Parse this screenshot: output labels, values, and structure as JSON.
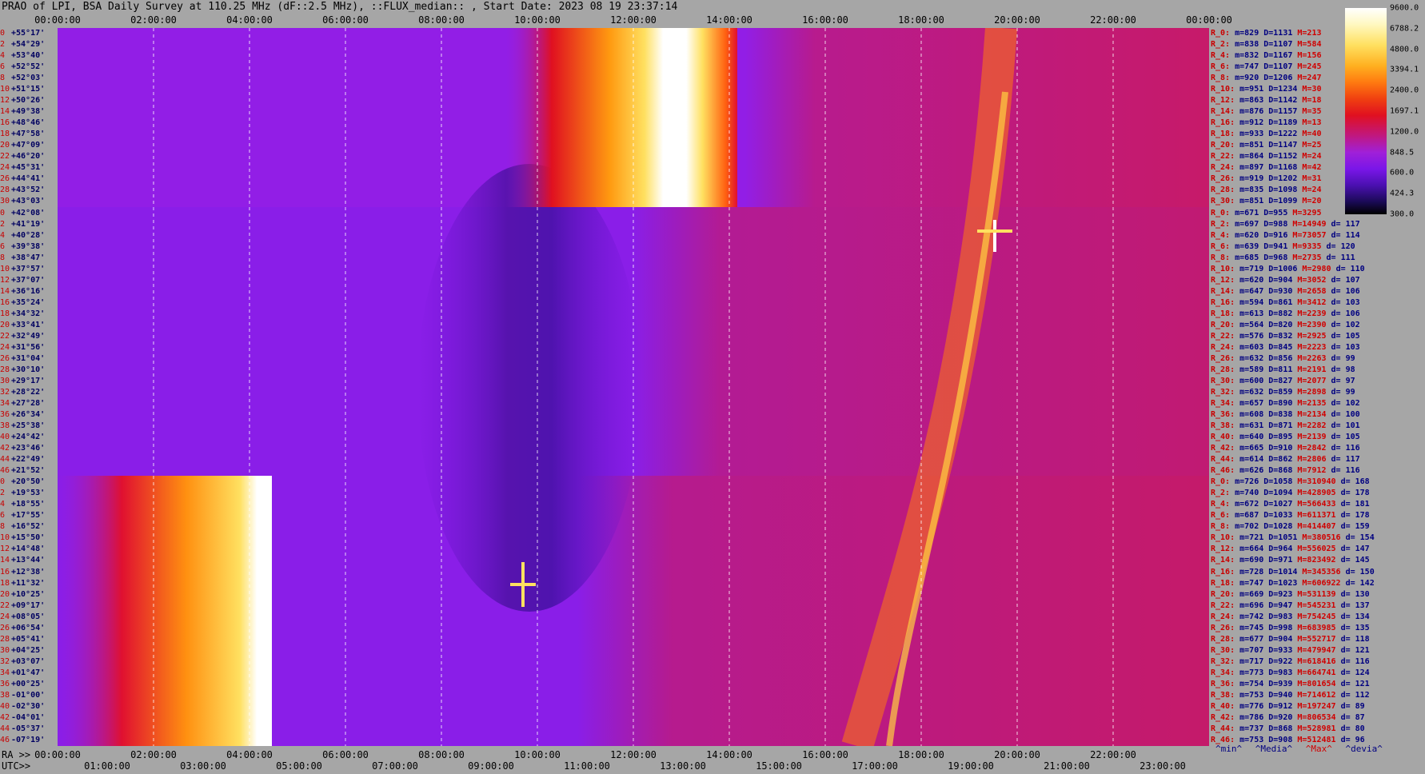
{
  "title": "PRAO of LPI, BSA Daily Survey at 110.25 MHz (dF::2.5 MHz), ::FLUX_median:: , Start Date: 2023 08 19 23:37:14",
  "top_axis": [
    "00:00:00",
    "02:00:00",
    "04:00:00",
    "06:00:00",
    "08:00:00",
    "10:00:00",
    "12:00:00",
    "14:00:00",
    "16:00:00",
    "18:00:00",
    "20:00:00",
    "22:00:00",
    "00:00:00"
  ],
  "ra_axis_label": "RA >>",
  "ra_axis": [
    "00:00:00",
    "02:00:00",
    "04:00:00",
    "06:00:00",
    "08:00:00",
    "10:00:00",
    "12:00:00",
    "14:00:00",
    "16:00:00",
    "18:00:00",
    "20:00:00",
    "22:00:00"
  ],
  "utc_axis_label": "UTC>>",
  "utc_axis": [
    "01:00:00",
    "03:00:00",
    "05:00:00",
    "07:00:00",
    "09:00:00",
    "11:00:00",
    "13:00:00",
    "15:00:00",
    "17:00:00",
    "19:00:00",
    "21:00:00",
    "23:00:00"
  ],
  "colorbar_labels": [
    "9600.0",
    "6788.2",
    "4800.0",
    "3394.1",
    "2400.0",
    "1697.1",
    "1200.0",
    "848.5",
    "600.0",
    "424.3",
    "300.0"
  ],
  "declinations": [
    "+55°17'",
    "+54°29'",
    "+53°40'",
    "+52°52'",
    "+52°03'",
    "+51°15'",
    "+50°26'",
    "+49°38'",
    "+48°46'",
    "+47°58'",
    "+47°09'",
    "+46°20'",
    "+45°31'",
    "+44°41'",
    "+43°52'",
    "+43°03'",
    "+42°08'",
    "+41°19'",
    "+40°28'",
    "+39°38'",
    "+38°47'",
    "+37°57'",
    "+37°07'",
    "+36°16'",
    "+35°24'",
    "+34°32'",
    "+33°41'",
    "+32°49'",
    "+31°56'",
    "+31°04'",
    "+30°10'",
    "+29°17'",
    "+28°22'",
    "+27°28'",
    "+26°34'",
    "+25°38'",
    "+24°42'",
    "+23°46'",
    "+22°49'",
    "+21°52'",
    "+20°50'",
    "+19°53'",
    "+18°55'",
    "+17°55'",
    "+16°52'",
    "+15°50'",
    "+14°48'",
    "+13°44'",
    "+12°38'",
    "+11°32'",
    "+10°25'",
    "+09°17'",
    "+08°05'",
    "+06°54'",
    "+05°41'",
    "+04°25'",
    "+03°07'",
    "+01°47'",
    "+00°25'",
    "-01°00'",
    "-02°30'",
    "-04°01'",
    "-05°37'",
    "-07°19'"
  ],
  "row_index": [
    "0",
    "2",
    "4",
    "6",
    "8",
    "10",
    "12",
    "14",
    "16",
    "18",
    "20",
    "22",
    "24",
    "26",
    "28",
    "30",
    "0",
    "2",
    "4",
    "6",
    "8",
    "10",
    "12",
    "14",
    "16",
    "18",
    "20",
    "22",
    "24",
    "26",
    "28",
    "30",
    "32",
    "34",
    "36",
    "38",
    "40",
    "42",
    "44",
    "46",
    "0",
    "2",
    "4",
    "6",
    "8",
    "10",
    "12",
    "14",
    "16",
    "18",
    "20",
    "22",
    "24",
    "26",
    "28",
    "30",
    "32",
    "34",
    "36",
    "38",
    "40",
    "42",
    "44",
    "46"
  ],
  "stats": [
    {
      "r": "R_0:",
      "m": "829",
      "d": "1131",
      "M": "213",
      "dv": ""
    },
    {
      "r": "R_2:",
      "m": "838",
      "d": "1107",
      "M": "584",
      "dv": ""
    },
    {
      "r": "R_4:",
      "m": "832",
      "d": "1167",
      "M": "156",
      "dv": ""
    },
    {
      "r": "R_6:",
      "m": "747",
      "d": "1107",
      "M": "245",
      "dv": ""
    },
    {
      "r": "R_8:",
      "m": "920",
      "d": "1206",
      "M": "247",
      "dv": ""
    },
    {
      "r": "R_10:",
      "m": "951",
      "d": "1234",
      "M": "30",
      "dv": ""
    },
    {
      "r": "R_12:",
      "m": "863",
      "d": "1142",
      "M": "18",
      "dv": ""
    },
    {
      "r": "R_14:",
      "m": "876",
      "d": "1157",
      "M": "35",
      "dv": ""
    },
    {
      "r": "R_16:",
      "m": "912",
      "d": "1189",
      "M": "13",
      "dv": ""
    },
    {
      "r": "R_18:",
      "m": "933",
      "d": "1222",
      "M": "40",
      "dv": ""
    },
    {
      "r": "R_20:",
      "m": "851",
      "d": "1147",
      "M": "25",
      "dv": ""
    },
    {
      "r": "R_22:",
      "m": "864",
      "d": "1152",
      "M": "24",
      "dv": ""
    },
    {
      "r": "R_24:",
      "m": "897",
      "d": "1168",
      "M": "42",
      "dv": ""
    },
    {
      "r": "R_26:",
      "m": "919",
      "d": "1202",
      "M": "31",
      "dv": ""
    },
    {
      "r": "R_28:",
      "m": "835",
      "d": "1098",
      "M": "24",
      "dv": ""
    },
    {
      "r": "R_30:",
      "m": "851",
      "d": "1099",
      "M": "20",
      "dv": ""
    },
    {
      "r": "R_0:",
      "m": "671",
      "d": "955",
      "M": "3295",
      "dv": ""
    },
    {
      "r": "R_2:",
      "m": "697",
      "d": "988",
      "M": "14949",
      "dv": "117"
    },
    {
      "r": "R_4:",
      "m": "620",
      "d": "916",
      "M": "73057",
      "dv": "114"
    },
    {
      "r": "R_6:",
      "m": "639",
      "d": "941",
      "M": "9335",
      "dv": "120"
    },
    {
      "r": "R_8:",
      "m": "685",
      "d": "968",
      "M": "2735",
      "dv": "111"
    },
    {
      "r": "R_10:",
      "m": "719",
      "d": "1006",
      "M": "2980",
      "dv": "110"
    },
    {
      "r": "R_12:",
      "m": "620",
      "d": "904",
      "M": "3052",
      "dv": "107"
    },
    {
      "r": "R_14:",
      "m": "647",
      "d": "930",
      "M": "2658",
      "dv": "106"
    },
    {
      "r": "R_16:",
      "m": "594",
      "d": "861",
      "M": "3412",
      "dv": "103"
    },
    {
      "r": "R_18:",
      "m": "613",
      "d": "882",
      "M": "2239",
      "dv": "106"
    },
    {
      "r": "R_20:",
      "m": "564",
      "d": "820",
      "M": "2390",
      "dv": "102"
    },
    {
      "r": "R_22:",
      "m": "576",
      "d": "832",
      "M": "2925",
      "dv": "105"
    },
    {
      "r": "R_24:",
      "m": "603",
      "d": "845",
      "M": "2223",
      "dv": "103"
    },
    {
      "r": "R_26:",
      "m": "632",
      "d": "856",
      "M": "2263",
      "dv": "99"
    },
    {
      "r": "R_28:",
      "m": "589",
      "d": "811",
      "M": "2191",
      "dv": "98"
    },
    {
      "r": "R_30:",
      "m": "600",
      "d": "827",
      "M": "2077",
      "dv": "97"
    },
    {
      "r": "R_32:",
      "m": "632",
      "d": "859",
      "M": "2898",
      "dv": "99"
    },
    {
      "r": "R_34:",
      "m": "657",
      "d": "890",
      "M": "2135",
      "dv": "102"
    },
    {
      "r": "R_36:",
      "m": "608",
      "d": "838",
      "M": "2134",
      "dv": "100"
    },
    {
      "r": "R_38:",
      "m": "631",
      "d": "871",
      "M": "2282",
      "dv": "101"
    },
    {
      "r": "R_40:",
      "m": "640",
      "d": "895",
      "M": "2139",
      "dv": "105"
    },
    {
      "r": "R_42:",
      "m": "665",
      "d": "910",
      "M": "2842",
      "dv": "116"
    },
    {
      "r": "R_44:",
      "m": "614",
      "d": "862",
      "M": "2806",
      "dv": "117"
    },
    {
      "r": "R_46:",
      "m": "626",
      "d": "868",
      "M": "7912",
      "dv": "116"
    },
    {
      "r": "R_0:",
      "m": "726",
      "d": "1058",
      "M": "310940",
      "dv": "168"
    },
    {
      "r": "R_2:",
      "m": "740",
      "d": "1094",
      "M": "428905",
      "dv": "178"
    },
    {
      "r": "R_4:",
      "m": "672",
      "d": "1027",
      "M": "566433",
      "dv": "181"
    },
    {
      "r": "R_6:",
      "m": "687",
      "d": "1033",
      "M": "611371",
      "dv": "178"
    },
    {
      "r": "R_8:",
      "m": "702",
      "d": "1028",
      "M": "414407",
      "dv": "159"
    },
    {
      "r": "R_10:",
      "m": "721",
      "d": "1051",
      "M": "380516",
      "dv": "154"
    },
    {
      "r": "R_12:",
      "m": "664",
      "d": "964",
      "M": "556025",
      "dv": "147"
    },
    {
      "r": "R_14:",
      "m": "690",
      "d": "971",
      "M": "823492",
      "dv": "145"
    },
    {
      "r": "R_16:",
      "m": "728",
      "d": "1014",
      "M": "345356",
      "dv": "150"
    },
    {
      "r": "R_18:",
      "m": "747",
      "d": "1023",
      "M": "606922",
      "dv": "142"
    },
    {
      "r": "R_20:",
      "m": "669",
      "d": "923",
      "M": "531139",
      "dv": "130"
    },
    {
      "r": "R_22:",
      "m": "696",
      "d": "947",
      "M": "545231",
      "dv": "137"
    },
    {
      "r": "R_24:",
      "m": "742",
      "d": "983",
      "M": "754245",
      "dv": "134"
    },
    {
      "r": "R_26:",
      "m": "745",
      "d": "998",
      "M": "683985",
      "dv": "135"
    },
    {
      "r": "R_28:",
      "m": "677",
      "d": "904",
      "M": "552717",
      "dv": "118"
    },
    {
      "r": "R_30:",
      "m": "707",
      "d": "933",
      "M": "479947",
      "dv": "121"
    },
    {
      "r": "R_32:",
      "m": "717",
      "d": "922",
      "M": "618416",
      "dv": "116"
    },
    {
      "r": "R_34:",
      "m": "773",
      "d": "983",
      "M": "664741",
      "dv": "124"
    },
    {
      "r": "R_36:",
      "m": "754",
      "d": "939",
      "M": "801654",
      "dv": "121"
    },
    {
      "r": "R_38:",
      "m": "753",
      "d": "940",
      "M": "714612",
      "dv": "112"
    },
    {
      "r": "R_40:",
      "m": "776",
      "d": "912",
      "M": "197247",
      "dv": "89"
    },
    {
      "r": "R_42:",
      "m": "786",
      "d": "920",
      "M": "806534",
      "dv": "87"
    },
    {
      "r": "R_44:",
      "m": "737",
      "d": "868",
      "M": "528981",
      "dv": "80"
    },
    {
      "r": "R_46:",
      "m": "753",
      "d": "908",
      "M": "512481",
      "dv": "96"
    }
  ],
  "legend": {
    "min": "^min^",
    "media": "^Media^",
    "max": "^Max^",
    "devia": "^devia^"
  },
  "colors": {
    "background": "#a6a6a6",
    "base_purple": "#8a1ee8",
    "dark_purple": "#5012b0",
    "hot_red": "#e81020",
    "white": "#ffffff"
  }
}
